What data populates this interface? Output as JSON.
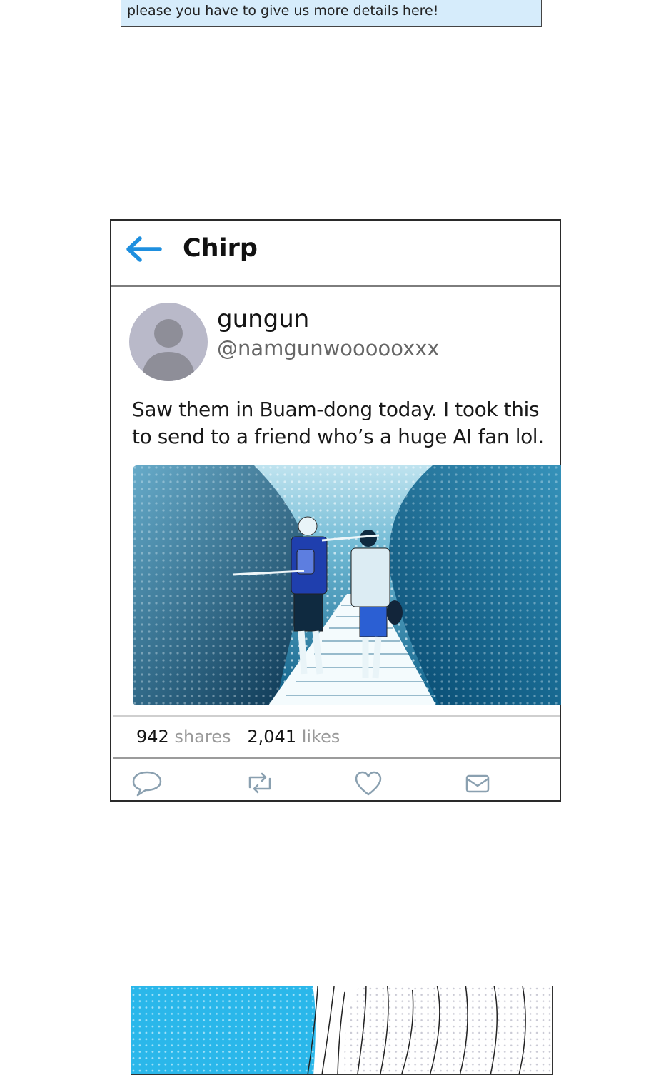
{
  "top_comment": {
    "text": "please you have to give us more details here!"
  },
  "app": {
    "title": "Chirp",
    "back_icon": "back-arrow-icon",
    "accent_color": "#1e8fdf"
  },
  "post": {
    "display_name": "gungun",
    "handle": "@namgunwoooooxxx",
    "text": "Saw them in Buam-dong today. I took this to send to a friend who’s a huge AI fan lol.",
    "photo_icon": "photo-two-people-walking-on-boardwalk",
    "shares_count": "942",
    "shares_label": "shares",
    "likes_count": "2,041",
    "likes_label": "likes"
  },
  "actions": [
    {
      "name": "reply-icon"
    },
    {
      "name": "retweet-icon"
    },
    {
      "name": "like-icon"
    },
    {
      "name": "message-icon"
    }
  ]
}
